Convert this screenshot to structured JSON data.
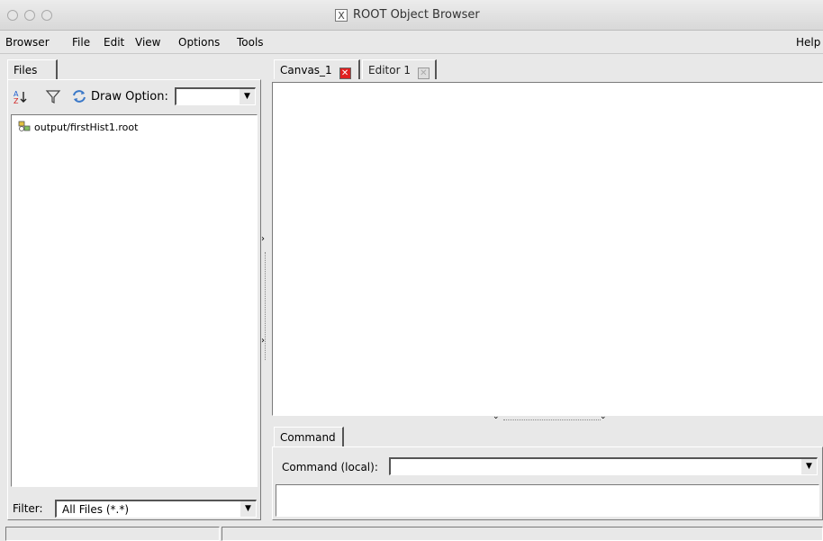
{
  "window": {
    "title": "ROOT Object Browser"
  },
  "menubar": {
    "items": [
      {
        "label": "Browser"
      },
      {
        "label": "File"
      },
      {
        "label": "Edit"
      },
      {
        "label": "View"
      },
      {
        "label": "Options"
      },
      {
        "label": "Tools"
      }
    ],
    "help": "Help"
  },
  "left_panel": {
    "tab_label": "Files",
    "toolbar": {
      "draw_option_label": "Draw Option:",
      "draw_option_value": ""
    },
    "tree": [
      {
        "label": "output/firstHist1.root",
        "icon": "root-file-icon"
      }
    ],
    "filter": {
      "label": "Filter:",
      "value": "All Files (*.*)"
    }
  },
  "right_panel": {
    "tabs": [
      {
        "label": "Canvas_1"
      },
      {
        "label": "Editor 1"
      }
    ],
    "command": {
      "tab_label": "Command",
      "label": "Command (local):",
      "value": ""
    }
  },
  "colors": {
    "background": "#e8e8e8",
    "close_red": "#e02020"
  }
}
